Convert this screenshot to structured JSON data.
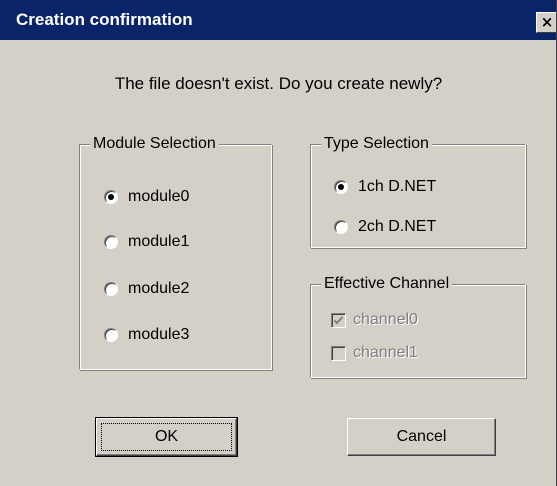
{
  "window": {
    "title": "Creation confirmation",
    "close_glyph": "×"
  },
  "message": "The file doesn't exist. Do you create newly?",
  "module_selection": {
    "label": "Module Selection",
    "options": [
      {
        "label": "module0",
        "checked": true
      },
      {
        "label": "module1",
        "checked": false
      },
      {
        "label": "module2",
        "checked": false
      },
      {
        "label": "module3",
        "checked": false
      }
    ]
  },
  "type_selection": {
    "label": "Type Selection",
    "options": [
      {
        "label": "1ch D.NET",
        "checked": true
      },
      {
        "label": "2ch D.NET",
        "checked": false
      }
    ]
  },
  "effective_channel": {
    "label": "Effective Channel",
    "channels": [
      {
        "label": "channel0",
        "checked": true,
        "disabled": true
      },
      {
        "label": "channel1",
        "checked": false,
        "disabled": true
      }
    ]
  },
  "buttons": {
    "ok": "OK",
    "cancel": "Cancel"
  },
  "colors": {
    "title_bar": "#0a246a",
    "face": "#d4d0c8"
  }
}
